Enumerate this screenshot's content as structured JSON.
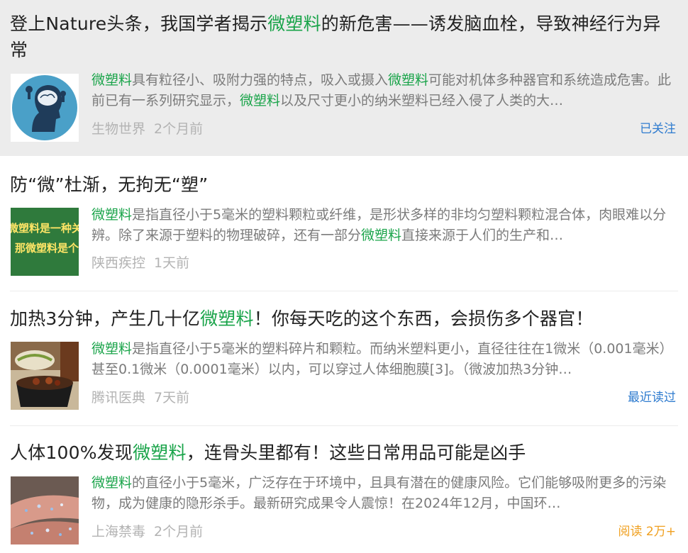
{
  "items": [
    {
      "title_parts": [
        "登上Nature头条，我国学者揭示",
        "微塑料",
        "的新危害——诱发脑血栓，导致神经行为异常"
      ],
      "snippet_parts": [
        "微塑料",
        "具有粒径小、吸附力强的特点，吸入或摄入",
        "微塑料",
        "可能对机体多种器官和系统造成危害。此前已有一系列研究显示，",
        "微塑料",
        "以及尺寸更小的纳米塑料已经入侵了人类的大…"
      ],
      "source": "生物世界",
      "time": "2个月前",
      "tag": "已关注",
      "thumb_icon": "brain-head-icon"
    },
    {
      "title_parts": [
        "防“微”杜渐，无拘无“塑”",
        "",
        ""
      ],
      "snippet_parts": [
        "微塑料",
        "是指直径小于5毫米的塑料颗粒或纤维，是形状多样的非均匀塑料颗粒混合体，肉眼难以分辨。除了来源于塑料的物理破碎，还有一部分",
        "微塑料",
        "直接来源于人们的生产和…",
        "",
        ""
      ],
      "source": "陕西疾控",
      "time": "1天前",
      "tag": "",
      "thumb_icon": "text-banner-icon",
      "thumb_text_1": "微塑料是一种关",
      "thumb_text_2": "那微塑料是个"
    },
    {
      "title_parts": [
        "加热3分钟，产生几十亿",
        "微塑料",
        "！你每天吃的这个东西，会损伤多个器官！"
      ],
      "snippet_parts": [
        "微塑料",
        "是指直径小于5毫米的塑料碎片和颗粒。而纳米塑料更小，直径往往在1微米（0.001毫米）甚至0.1微米（0.0001毫米）以内，可以穿过人体细胞膜[3]。（微波加热3分钟…",
        "",
        "",
        "",
        ""
      ],
      "source": "腾讯医典",
      "time": "7天前",
      "tag": "最近读过",
      "thumb_icon": "food-container-icon"
    },
    {
      "title_parts": [
        "人体100%发现",
        "微塑料",
        "，连骨头里都有！这些日常用品可能是凶手"
      ],
      "snippet_parts": [
        "微塑料",
        "的直径小于5毫米，广泛存在于环境中，且具有潜在的健康风险。它们能够吸附更多的污染物，成为健康的隐形杀手。最新研究成果令人震惊！在2024年12月，中国环…",
        "",
        "",
        "",
        ""
      ],
      "source": "上海禁毒",
      "time": "2个月前",
      "tag": "阅读 2万+",
      "thumb_icon": "fingers-particles-icon"
    }
  ],
  "colors": {
    "highlight": "#1aa44a",
    "followed": "#2e7bcf",
    "read_count": "#f0a020"
  }
}
